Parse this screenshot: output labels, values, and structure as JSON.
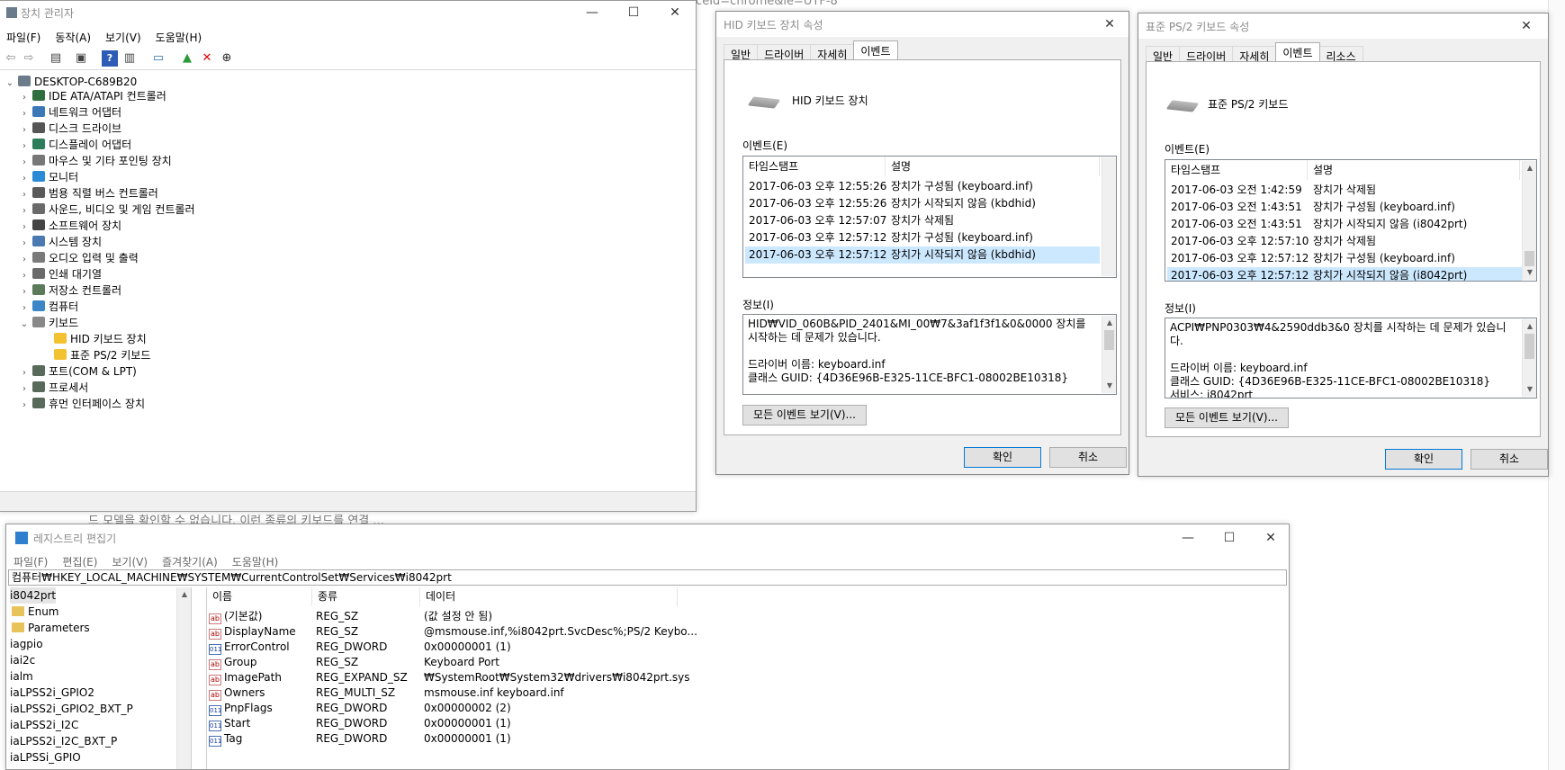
{
  "background": {
    "url_fragment": "rceId=chrome&ie=UTF-8",
    "text_fragment": "드 모델을 확인할 수 없습니다. 이런 종류의 키보드를 연결 ..."
  },
  "device_manager": {
    "title": "장치 관리자",
    "menu": [
      "파일(F)",
      "동작(A)",
      "보기(V)",
      "도움말(H)"
    ],
    "root": "DESKTOP-C689B20",
    "categories": [
      "IDE ATA/ATAPI 컨트롤러",
      "네트워크 어댑터",
      "디스크 드라이브",
      "디스플레이 어댑터",
      "마우스 및 기타 포인팅 장치",
      "모니터",
      "범용 직렬 버스 컨트롤러",
      "사운드, 비디오 및 게임 컨트롤러",
      "소프트웨어 장치",
      "시스템 장치",
      "오디오 입력 및 출력",
      "인쇄 대기열",
      "저장소 컨트롤러",
      "컴퓨터",
      "키보드"
    ],
    "keyboard_children": [
      "HID 키보드 장치",
      "표준 PS/2 키보드"
    ],
    "after_categories": [
      "포트(COM & LPT)",
      "프로세서",
      "휴먼 인터페이스 장치"
    ]
  },
  "hid_dialog": {
    "title": "HID 키보드 장치 속성",
    "tabs": [
      "일반",
      "드라이버",
      "자세히",
      "이벤트"
    ],
    "active_tab": "이벤트",
    "device_name": "HID 키보드 장치",
    "events_label": "이벤트(E)",
    "col_timestamp": "타임스탬프",
    "col_description": "설명",
    "events": [
      {
        "time": "2017-06-03 오후 12:55:26",
        "desc": "장치가 구성됨 (keyboard.inf)"
      },
      {
        "time": "2017-06-03 오후 12:55:26",
        "desc": "장치가 시작되지 않음 (kbdhid)"
      },
      {
        "time": "2017-06-03 오후 12:57:07",
        "desc": "장치가 삭제됨"
      },
      {
        "time": "2017-06-03 오후 12:57:12",
        "desc": "장치가 구성됨 (keyboard.inf)"
      },
      {
        "time": "2017-06-03 오후 12:57:12",
        "desc": "장치가 시작되지 않음 (kbdhid)"
      }
    ],
    "info_label": "정보(I)",
    "info_text": "HID₩VID_060B&PID_2401&MI_00₩7&3af1f3f1&0&0000 장치를 시작하는 데 문제가 있습니다.\n\n드라이버 이름: keyboard.inf\n클래스 GUID: {4D36E96B-E325-11CE-BFC1-08002BE10318}",
    "view_all_button": "모든 이벤트 보기(V)...",
    "ok_button": "확인",
    "cancel_button": "취소"
  },
  "ps2_dialog": {
    "title": "표준 PS/2 키보드 속성",
    "tabs": [
      "일반",
      "드라이버",
      "자세히",
      "이벤트",
      "리소스"
    ],
    "active_tab": "이벤트",
    "device_name": "표준 PS/2 키보드",
    "events_label": "이벤트(E)",
    "col_timestamp": "타임스탬프",
    "col_description": "설명",
    "events": [
      {
        "time": "2017-06-03 오전 1:42:59",
        "desc": "장치가 삭제됨"
      },
      {
        "time": "2017-06-03 오전 1:43:51",
        "desc": "장치가 구성됨 (keyboard.inf)"
      },
      {
        "time": "2017-06-03 오전 1:43:51",
        "desc": "장치가 시작되지 않음 (i8042prt)"
      },
      {
        "time": "2017-06-03 오후 12:57:10",
        "desc": "장치가 삭제됨"
      },
      {
        "time": "2017-06-03 오후 12:57:12",
        "desc": "장치가 구성됨 (keyboard.inf)"
      },
      {
        "time": "2017-06-03 오후 12:57:12",
        "desc": "장치가 시작되지 않음 (i8042prt)"
      }
    ],
    "info_label": "정보(I)",
    "info_text": "ACPI₩PNP0303₩4&2590ddb3&0 장치를 시작하는 데 문제가 있습니다.\n\n드라이버 이름: keyboard.inf\n클래스 GUID: {4D36E96B-E325-11CE-BFC1-08002BE10318}\n서비스: i8042prt",
    "view_all_button": "모든 이벤트 보기(V)...",
    "ok_button": "확인",
    "cancel_button": "취소"
  },
  "registry_editor": {
    "title": "레지스트리 편집기",
    "menu": [
      "파일(F)",
      "편집(E)",
      "보기(V)",
      "즐겨찾기(A)",
      "도움말(H)"
    ],
    "address": "컴퓨터₩HKEY_LOCAL_MACHINE₩SYSTEM₩CurrentControlSet₩Services₩i8042prt",
    "tree": [
      {
        "label": "i8042prt",
        "folder": false,
        "indent": 0,
        "selected": true
      },
      {
        "label": "Enum",
        "folder": true,
        "indent": 1,
        "selected": false
      },
      {
        "label": "Parameters",
        "folder": true,
        "indent": 1,
        "selected": false
      },
      {
        "label": "iagpio",
        "folder": false,
        "indent": 0,
        "selected": false
      },
      {
        "label": "iai2c",
        "folder": false,
        "indent": 0,
        "selected": false
      },
      {
        "label": "ialm",
        "folder": false,
        "indent": 0,
        "selected": false
      },
      {
        "label": "iaLPSS2i_GPIO2",
        "folder": false,
        "indent": 0,
        "selected": false
      },
      {
        "label": "iaLPSS2i_GPIO2_BXT_P",
        "folder": false,
        "indent": 0,
        "selected": false
      },
      {
        "label": "iaLPSS2i_I2C",
        "folder": false,
        "indent": 0,
        "selected": false
      },
      {
        "label": "iaLPSS2i_I2C_BXT_P",
        "folder": false,
        "indent": 0,
        "selected": false
      },
      {
        "label": "iaLPSSi_GPIO",
        "folder": false,
        "indent": 0,
        "selected": false
      }
    ],
    "col_name": "이름",
    "col_type": "종류",
    "col_data": "데이터",
    "values": [
      {
        "icon": "ab",
        "name": "(기본값)",
        "type": "REG_SZ",
        "data": "(값 설정 안 됨)"
      },
      {
        "icon": "ab",
        "name": "DisplayName",
        "type": "REG_SZ",
        "data": "@msmouse.inf,%i8042prt.SvcDesc%;PS/2 Keybo..."
      },
      {
        "icon": "bin",
        "name": "ErrorControl",
        "type": "REG_DWORD",
        "data": "0x00000001 (1)"
      },
      {
        "icon": "ab",
        "name": "Group",
        "type": "REG_SZ",
        "data": "Keyboard Port"
      },
      {
        "icon": "ab",
        "name": "ImagePath",
        "type": "REG_EXPAND_SZ",
        "data": "₩SystemRoot₩System32₩drivers₩i8042prt.sys"
      },
      {
        "icon": "ab",
        "name": "Owners",
        "type": "REG_MULTI_SZ",
        "data": "msmouse.inf keyboard.inf"
      },
      {
        "icon": "bin",
        "name": "PnpFlags",
        "type": "REG_DWORD",
        "data": "0x00000002 (2)"
      },
      {
        "icon": "bin",
        "name": "Start",
        "type": "REG_DWORD",
        "data": "0x00000001 (1)"
      },
      {
        "icon": "bin",
        "name": "Tag",
        "type": "REG_DWORD",
        "data": "0x00000001 (1)"
      }
    ]
  }
}
